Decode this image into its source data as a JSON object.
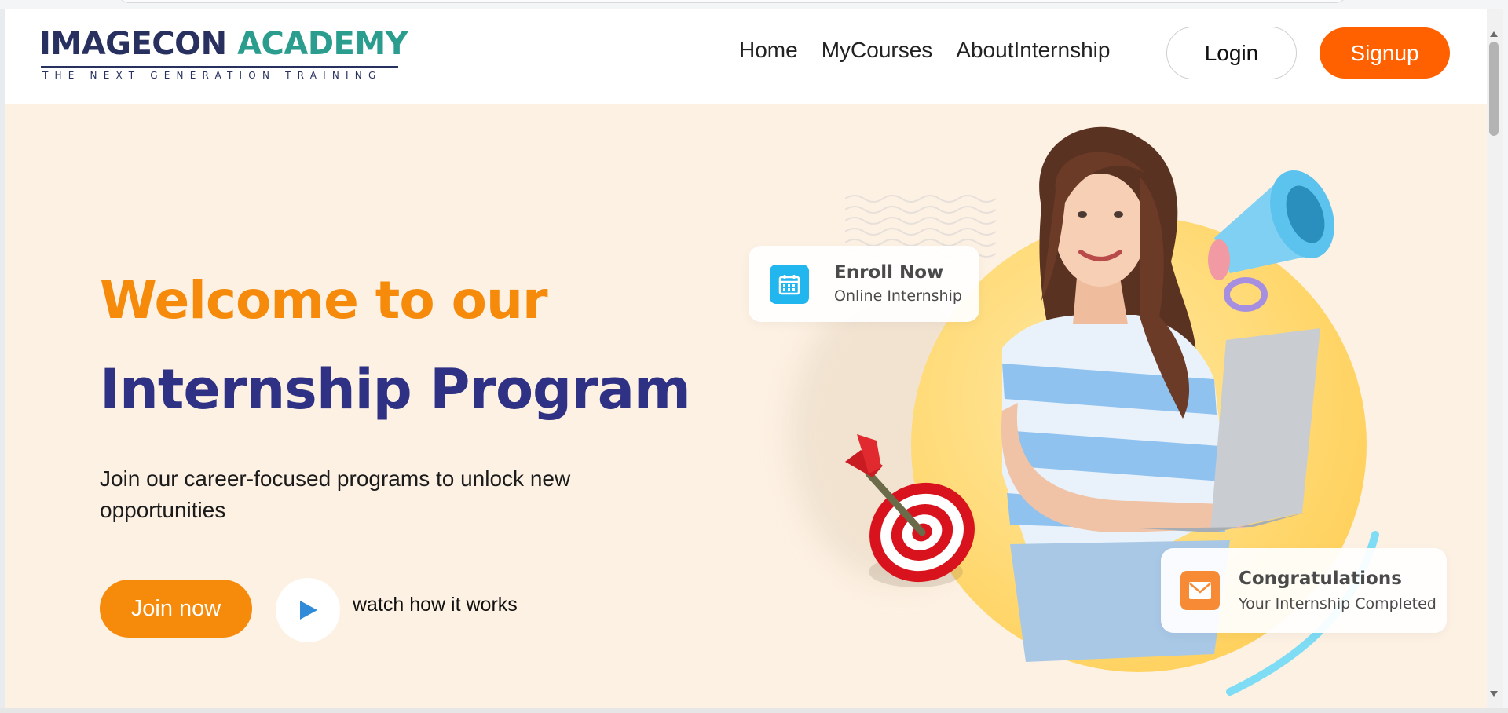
{
  "brand": {
    "name_part1": "IMAGECON",
    "name_part2": "ACADEMY",
    "tagline": "The Next Generation Training",
    "color_primary": "#27305f",
    "color_accent": "#2a9d8f"
  },
  "nav": {
    "items": [
      {
        "label": "Home"
      },
      {
        "label": "MyCourses"
      },
      {
        "label": "AboutInternship"
      }
    ],
    "login_label": "Login",
    "signup_label": "Signup",
    "signup_color": "#ff6100"
  },
  "hero": {
    "title_line1": "Welcome to our",
    "title_line2": "Internship Program",
    "subtitle": "Join our career-focused programs to unlock new opportunities",
    "join_label": "Join now",
    "watch_label": "watch how it works",
    "title1_color": "#f58a0b",
    "title2_color": "#2e3184"
  },
  "cards": {
    "enroll": {
      "title": "Enroll Now",
      "subtitle": "Online Internship",
      "icon": "calendar-icon"
    },
    "congrats": {
      "title": "Congratulations",
      "subtitle": "Your Internship Completed",
      "icon": "mail-icon"
    }
  }
}
